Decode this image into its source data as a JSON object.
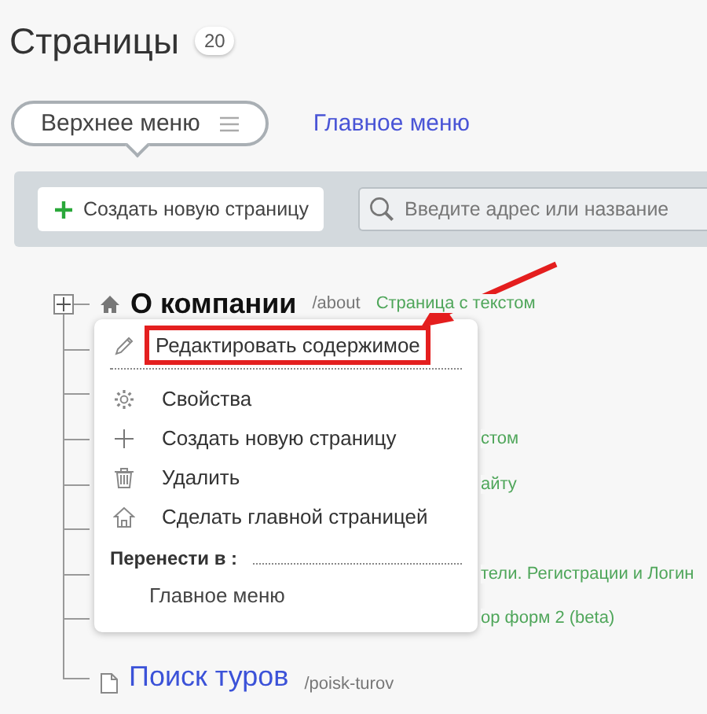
{
  "title": "Страницы",
  "page_count": "20",
  "menus": [
    {
      "label": "Верхнее меню",
      "selected": true
    },
    {
      "label": "Главное меню",
      "selected": false
    }
  ],
  "toolbar": {
    "create_button": "Создать новую страницу",
    "search": {
      "placeholder": "Введите адрес или название"
    }
  },
  "pages": [
    {
      "kind": "home",
      "title": "О компании",
      "path": "/about",
      "type_label": "Страница с текстом",
      "expanded": false
    },
    {
      "kind": "hidden"
    },
    {
      "kind": "hidden"
    },
    {
      "kind": "partial",
      "type_label": "стом"
    },
    {
      "kind": "partial",
      "type_label": "айту"
    },
    {
      "kind": "hidden"
    },
    {
      "kind": "partial",
      "type_label": "тели. Регистрации и Логин"
    },
    {
      "kind": "partial",
      "type_label": "ор форм 2 (beta)"
    },
    {
      "kind": "page",
      "title": "Поиск туров",
      "path": "/poisk-turov"
    }
  ],
  "context_menu": {
    "items": [
      {
        "kind": "edit",
        "label": "Редактировать содержимое",
        "highlighted": true
      },
      {
        "kind": "settings",
        "label": "Свойства",
        "highlighted": false
      },
      {
        "kind": "create",
        "label": "Создать новую страницу",
        "highlighted": false
      },
      {
        "kind": "delete",
        "label": "Удалить",
        "highlighted": false
      },
      {
        "kind": "make_home",
        "label": "Сделать главной страницей",
        "highlighted": false
      }
    ],
    "move_label": "Перенести в :",
    "move_targets": [
      "Главное меню"
    ]
  }
}
